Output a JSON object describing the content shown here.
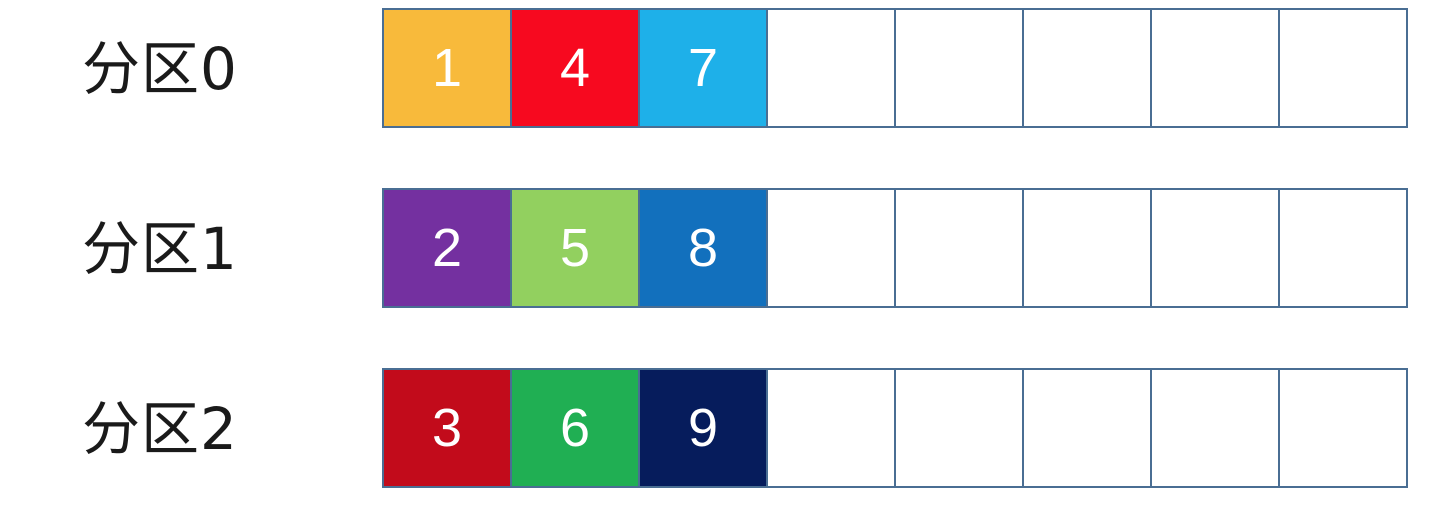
{
  "partitions": [
    {
      "label": "分区0",
      "cells": [
        {
          "value": "1",
          "color": "#F8BA3B"
        },
        {
          "value": "4",
          "color": "#F7091F"
        },
        {
          "value": "7",
          "color": "#1EB0E9"
        },
        {
          "value": "",
          "color": ""
        },
        {
          "value": "",
          "color": ""
        },
        {
          "value": "",
          "color": ""
        },
        {
          "value": "",
          "color": ""
        },
        {
          "value": "",
          "color": ""
        }
      ]
    },
    {
      "label": "分区1",
      "cells": [
        {
          "value": "2",
          "color": "#7430A0"
        },
        {
          "value": "5",
          "color": "#92D05F"
        },
        {
          "value": "8",
          "color": "#1270BD"
        },
        {
          "value": "",
          "color": ""
        },
        {
          "value": "",
          "color": ""
        },
        {
          "value": "",
          "color": ""
        },
        {
          "value": "",
          "color": ""
        },
        {
          "value": "",
          "color": ""
        }
      ]
    },
    {
      "label": "分区2",
      "cells": [
        {
          "value": "3",
          "color": "#C20B1B"
        },
        {
          "value": "6",
          "color": "#20AF53"
        },
        {
          "value": "9",
          "color": "#061C5C"
        },
        {
          "value": "",
          "color": ""
        },
        {
          "value": "",
          "color": ""
        },
        {
          "value": "",
          "color": ""
        },
        {
          "value": "",
          "color": ""
        },
        {
          "value": "",
          "color": ""
        }
      ]
    }
  ],
  "colors": {
    "grid_border": "#4A6E93",
    "cell_text": "#FFFFFF",
    "empty_cell": "#FFFFFF"
  }
}
